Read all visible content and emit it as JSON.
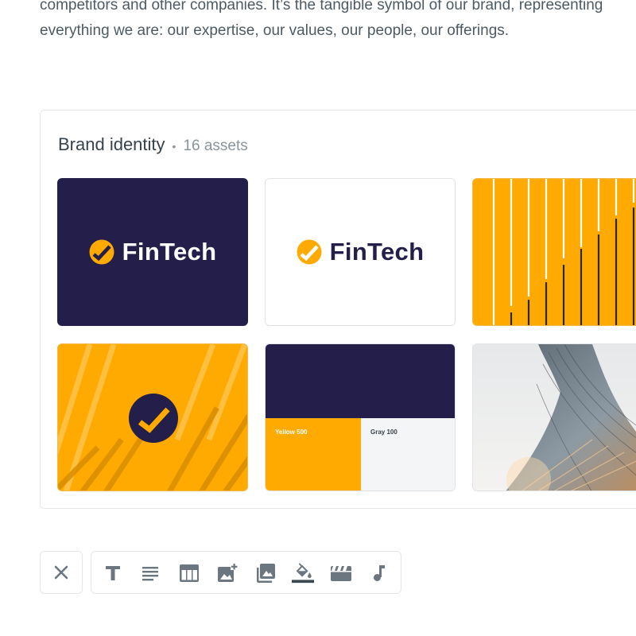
{
  "intro": {
    "text": "competitors and other companies. It’s the tangible symbol of our brand, representing everything we are: our expertise, our values, our people, our offerings."
  },
  "panel": {
    "title": "Brand identity",
    "separator": "•",
    "count": "16 assets"
  },
  "assets": [
    {
      "kind": "logo-dark",
      "logo_text": "FinTech"
    },
    {
      "kind": "logo-light",
      "logo_text": "FinTech"
    },
    {
      "kind": "bar-pattern"
    },
    {
      "kind": "icon-pattern"
    },
    {
      "kind": "color-swatches",
      "swatch_left": "Yellow 500",
      "swatch_right": "Gray 100"
    },
    {
      "kind": "photo-building"
    }
  ],
  "colors": {
    "navy": "#231f4a",
    "yellow": "#ffaa00",
    "gray_100": "#f4f5f7",
    "icon_gray": "#6b7680"
  },
  "toolbar": {
    "close_icon": "close-icon",
    "tools": [
      "text-icon",
      "paragraph-icon",
      "table-icon",
      "add-image-icon",
      "gallery-icon",
      "fill-color-icon",
      "video-icon",
      "audio-icon"
    ]
  }
}
